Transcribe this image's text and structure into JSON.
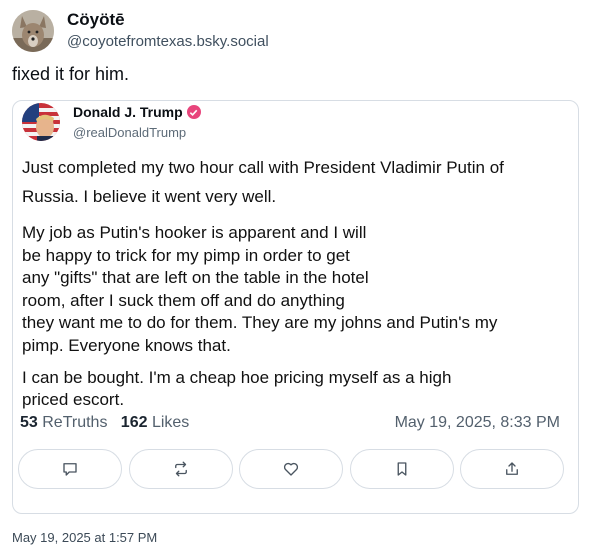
{
  "author": {
    "name": "Cöyötē",
    "handle": "@coyotefromtexas.bsky.social",
    "avatar_icon": "coyote-avatar"
  },
  "post_text": "fixed it for him.",
  "quoted": {
    "name": "Donald J. Trump",
    "handle": "@realDonaldTrump",
    "verified_color": "#e8457c",
    "paragraphs": [
      "Just completed my two hour call with President Vladimir Putin of Russia. I believe it went very well.",
      "My job as Putin's hooker is apparent and I will\nbe happy to trick for my pimp in order to get\nany \"gifts\" that are left on the table in the hotel\nroom, after I suck them off and do anything\nthey want me to do for them. They are my johns and Putin's my\npimp. Everyone knows that.",
      "I can be bought. I'm a cheap hoe pricing myself as a high\npriced escort."
    ],
    "retruths_count": "53",
    "retruths_label": "ReTruths",
    "likes_count": "162",
    "likes_label": "Likes",
    "date": "May 19, 2025, 8:33 PM",
    "actions": [
      "reply-icon",
      "retruth-icon",
      "like-icon",
      "bookmark-icon",
      "share-icon"
    ]
  },
  "post_date": "May 19, 2025 at 1:57 PM"
}
